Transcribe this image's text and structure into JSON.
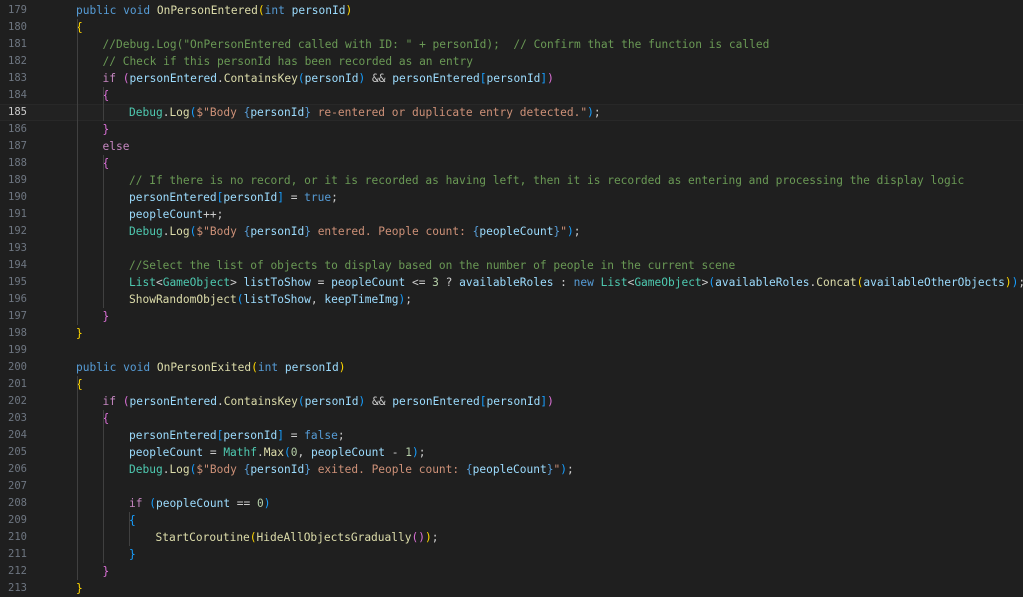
{
  "editor": {
    "language": "csharp",
    "current_line": 185,
    "token_colors": {
      "keyword": "#569cd6",
      "control": "#c586c0",
      "function": "#dcdcaa",
      "variable": "#9cdcfe",
      "type": "#4ec9b0",
      "string": "#ce9178",
      "number": "#b5cea8",
      "comment": "#6a9955",
      "bracket_level_1": "#ffd700",
      "bracket_level_2": "#da70d6",
      "bracket_level_3": "#179fff"
    },
    "lines": [
      {
        "n": "179",
        "t": [
          [
            "kw",
            "public "
          ],
          [
            "kw",
            "void "
          ],
          [
            "fn",
            "OnPersonEntered"
          ],
          [
            "b1",
            "("
          ],
          [
            "kw",
            "int "
          ],
          [
            "var",
            "personId"
          ],
          [
            "b1",
            ")"
          ]
        ]
      },
      {
        "n": "180",
        "t": [
          [
            "b1",
            "{"
          ]
        ]
      },
      {
        "n": "181",
        "t": [
          [
            "cmt",
            "//Debug.Log(\"OnPersonEntered called with ID: \" + personId);  // Confirm that the function is called"
          ]
        ]
      },
      {
        "n": "182",
        "t": [
          [
            "cmt",
            "// Check if this personId has been recorded as an entry"
          ]
        ]
      },
      {
        "n": "183",
        "t": [
          [
            "ctl",
            "if "
          ],
          [
            "b2",
            "("
          ],
          [
            "var",
            "personEntered"
          ],
          [
            "pun",
            "."
          ],
          [
            "fn",
            "ContainsKey"
          ],
          [
            "b3",
            "("
          ],
          [
            "var",
            "personId"
          ],
          [
            "b3",
            ")"
          ],
          [
            "pun",
            " && "
          ],
          [
            "var",
            "personEntered"
          ],
          [
            "b3",
            "["
          ],
          [
            "var",
            "personId"
          ],
          [
            "b3",
            "]"
          ],
          [
            "b2",
            ")"
          ]
        ]
      },
      {
        "n": "184",
        "t": [
          [
            "b2",
            "{"
          ]
        ]
      },
      {
        "n": "185",
        "t": [
          [
            "type",
            "Debug"
          ],
          [
            "pun",
            "."
          ],
          [
            "fn",
            "Log"
          ],
          [
            "b3",
            "("
          ],
          [
            "str",
            "$\"Body "
          ],
          [
            "kw",
            "{"
          ],
          [
            "var",
            "personId"
          ],
          [
            "kw",
            "}"
          ],
          [
            "str",
            " re-entered or duplicate entry detected.\""
          ],
          [
            "b3",
            ")"
          ],
          [
            "pun",
            ";"
          ]
        ]
      },
      {
        "n": "186",
        "t": [
          [
            "b2",
            "}"
          ]
        ]
      },
      {
        "n": "187",
        "t": [
          [
            "ctl",
            "else"
          ]
        ]
      },
      {
        "n": "188",
        "t": [
          [
            "b2",
            "{"
          ]
        ]
      },
      {
        "n": "189",
        "t": [
          [
            "cmt",
            "// If there is no record, or it is recorded as having left, then it is recorded as entering and processing the display logic"
          ]
        ]
      },
      {
        "n": "190",
        "t": [
          [
            "var",
            "personEntered"
          ],
          [
            "b3",
            "["
          ],
          [
            "var",
            "personId"
          ],
          [
            "b3",
            "]"
          ],
          [
            "pun",
            " = "
          ],
          [
            "kw",
            "true"
          ],
          [
            "pun",
            ";"
          ]
        ]
      },
      {
        "n": "191",
        "t": [
          [
            "var",
            "peopleCount"
          ],
          [
            "pun",
            "++;"
          ]
        ]
      },
      {
        "n": "192",
        "t": [
          [
            "type",
            "Debug"
          ],
          [
            "pun",
            "."
          ],
          [
            "fn",
            "Log"
          ],
          [
            "b3",
            "("
          ],
          [
            "str",
            "$\"Body "
          ],
          [
            "kw",
            "{"
          ],
          [
            "var",
            "personId"
          ],
          [
            "kw",
            "}"
          ],
          [
            "str",
            " entered. People count: "
          ],
          [
            "kw",
            "{"
          ],
          [
            "var",
            "peopleCount"
          ],
          [
            "kw",
            "}"
          ],
          [
            "str",
            "\""
          ],
          [
            "b3",
            ")"
          ],
          [
            "pun",
            ";"
          ]
        ]
      },
      {
        "n": "193",
        "t": []
      },
      {
        "n": "194",
        "t": [
          [
            "cmt",
            "//Select the list of objects to display based on the number of people in the current scene"
          ]
        ]
      },
      {
        "n": "195",
        "t": [
          [
            "type",
            "List"
          ],
          [
            "pun",
            "<"
          ],
          [
            "type",
            "GameObject"
          ],
          [
            "pun",
            "> "
          ],
          [
            "var",
            "listToShow"
          ],
          [
            "pun",
            " = "
          ],
          [
            "var",
            "peopleCount"
          ],
          [
            "pun",
            " <= "
          ],
          [
            "num",
            "3"
          ],
          [
            "pun",
            " ? "
          ],
          [
            "var",
            "availableRoles"
          ],
          [
            "pun",
            " : "
          ],
          [
            "kw",
            "new "
          ],
          [
            "type",
            "List"
          ],
          [
            "pun",
            "<"
          ],
          [
            "type",
            "GameObject"
          ],
          [
            "pun",
            ">"
          ],
          [
            "b3",
            "("
          ],
          [
            "var",
            "availableRoles"
          ],
          [
            "pun",
            "."
          ],
          [
            "fn",
            "Concat"
          ],
          [
            "b1",
            "("
          ],
          [
            "var",
            "availableOtherObjects"
          ],
          [
            "b1",
            ")"
          ],
          [
            "b3",
            ")"
          ],
          [
            "pun",
            ";"
          ]
        ]
      },
      {
        "n": "196",
        "t": [
          [
            "fn",
            "ShowRandomObject"
          ],
          [
            "b3",
            "("
          ],
          [
            "var",
            "listToShow"
          ],
          [
            "pun",
            ", "
          ],
          [
            "var",
            "keepTimeImg"
          ],
          [
            "b3",
            ")"
          ],
          [
            "pun",
            ";"
          ]
        ]
      },
      {
        "n": "197",
        "t": [
          [
            "b2",
            "}"
          ]
        ]
      },
      {
        "n": "198",
        "t": [
          [
            "b1",
            "}"
          ]
        ]
      },
      {
        "n": "199",
        "t": []
      },
      {
        "n": "200",
        "t": [
          [
            "kw",
            "public "
          ],
          [
            "kw",
            "void "
          ],
          [
            "fn",
            "OnPersonExited"
          ],
          [
            "b1",
            "("
          ],
          [
            "kw",
            "int "
          ],
          [
            "var",
            "personId"
          ],
          [
            "b1",
            ")"
          ]
        ]
      },
      {
        "n": "201",
        "t": [
          [
            "b1",
            "{"
          ]
        ]
      },
      {
        "n": "202",
        "t": [
          [
            "ctl",
            "if "
          ],
          [
            "b2",
            "("
          ],
          [
            "var",
            "personEntered"
          ],
          [
            "pun",
            "."
          ],
          [
            "fn",
            "ContainsKey"
          ],
          [
            "b3",
            "("
          ],
          [
            "var",
            "personId"
          ],
          [
            "b3",
            ")"
          ],
          [
            "pun",
            " && "
          ],
          [
            "var",
            "personEntered"
          ],
          [
            "b3",
            "["
          ],
          [
            "var",
            "personId"
          ],
          [
            "b3",
            "]"
          ],
          [
            "b2",
            ")"
          ]
        ]
      },
      {
        "n": "203",
        "t": [
          [
            "b2",
            "{"
          ]
        ]
      },
      {
        "n": "204",
        "t": [
          [
            "var",
            "personEntered"
          ],
          [
            "b3",
            "["
          ],
          [
            "var",
            "personId"
          ],
          [
            "b3",
            "]"
          ],
          [
            "pun",
            " = "
          ],
          [
            "kw",
            "false"
          ],
          [
            "pun",
            ";"
          ]
        ]
      },
      {
        "n": "205",
        "t": [
          [
            "var",
            "peopleCount"
          ],
          [
            "pun",
            " = "
          ],
          [
            "type",
            "Mathf"
          ],
          [
            "pun",
            "."
          ],
          [
            "fn",
            "Max"
          ],
          [
            "b3",
            "("
          ],
          [
            "num",
            "0"
          ],
          [
            "pun",
            ", "
          ],
          [
            "var",
            "peopleCount"
          ],
          [
            "pun",
            " - "
          ],
          [
            "num",
            "1"
          ],
          [
            "b3",
            ")"
          ],
          [
            "pun",
            ";"
          ]
        ]
      },
      {
        "n": "206",
        "t": [
          [
            "type",
            "Debug"
          ],
          [
            "pun",
            "."
          ],
          [
            "fn",
            "Log"
          ],
          [
            "b3",
            "("
          ],
          [
            "str",
            "$\"Body "
          ],
          [
            "kw",
            "{"
          ],
          [
            "var",
            "personId"
          ],
          [
            "kw",
            "}"
          ],
          [
            "str",
            " exited. People count: "
          ],
          [
            "kw",
            "{"
          ],
          [
            "var",
            "peopleCount"
          ],
          [
            "kw",
            "}"
          ],
          [
            "str",
            "\""
          ],
          [
            "b3",
            ")"
          ],
          [
            "pun",
            ";"
          ]
        ]
      },
      {
        "n": "207",
        "t": []
      },
      {
        "n": "208",
        "t": [
          [
            "ctl",
            "if "
          ],
          [
            "b3",
            "("
          ],
          [
            "var",
            "peopleCount"
          ],
          [
            "pun",
            " == "
          ],
          [
            "num",
            "0"
          ],
          [
            "b3",
            ")"
          ]
        ]
      },
      {
        "n": "209",
        "t": [
          [
            "b3",
            "{"
          ]
        ]
      },
      {
        "n": "210",
        "t": [
          [
            "fn",
            "StartCoroutine"
          ],
          [
            "b1",
            "("
          ],
          [
            "fn",
            "HideAllObjectsGradually"
          ],
          [
            "b2",
            "()"
          ],
          [
            "b1",
            ")"
          ],
          [
            "pun",
            ";"
          ]
        ]
      },
      {
        "n": "211",
        "t": [
          [
            "b3",
            "}"
          ]
        ]
      },
      {
        "n": "212",
        "t": [
          [
            "b2",
            "}"
          ]
        ]
      },
      {
        "n": "213",
        "t": [
          [
            "b1",
            "}"
          ]
        ]
      }
    ]
  }
}
